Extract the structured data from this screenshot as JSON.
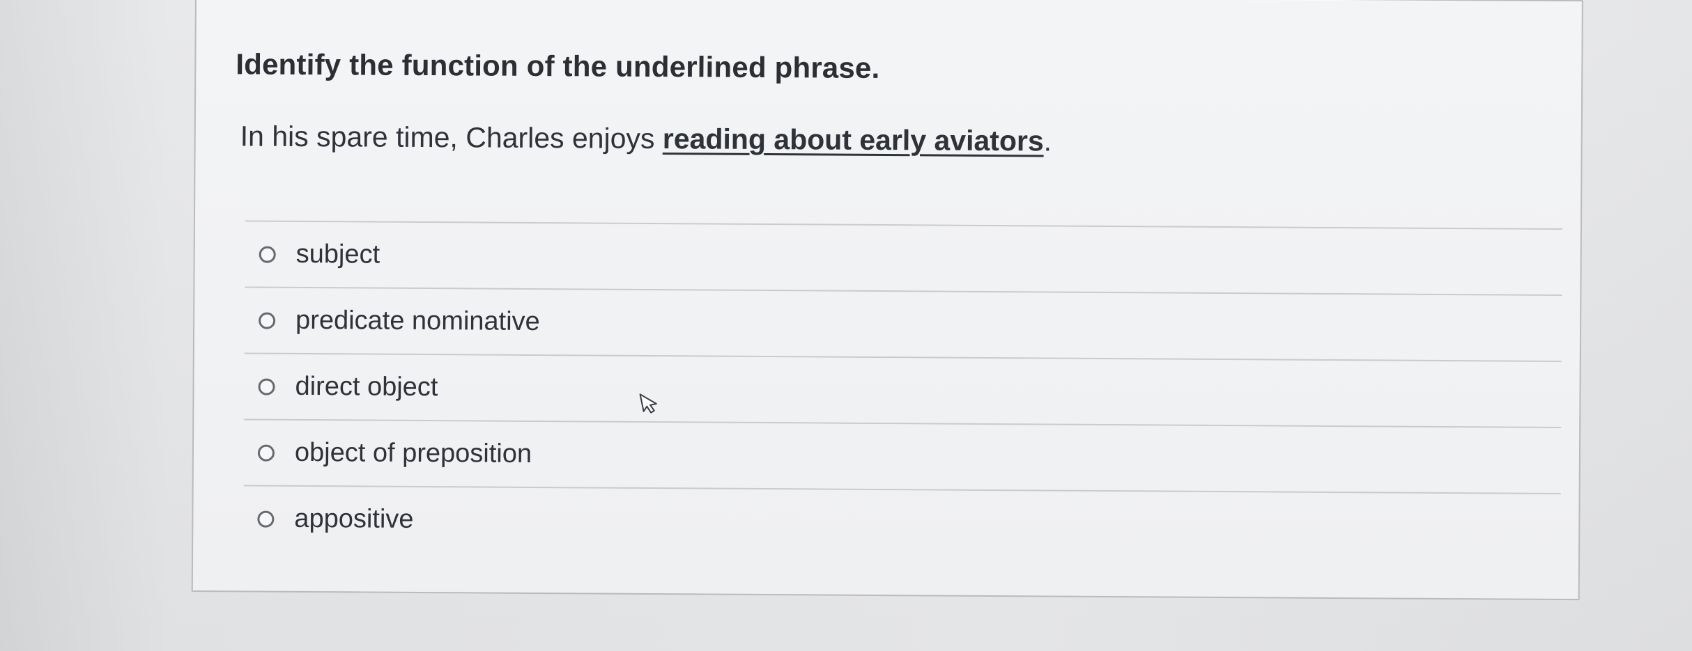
{
  "question": {
    "prompt": "Identify the function of the underlined phrase.",
    "sentence_start": "In his spare time, Charles enjoys ",
    "underlined_phrase": "reading about early aviators",
    "sentence_end": "."
  },
  "answers": [
    {
      "label": "subject",
      "selected": false
    },
    {
      "label": "predicate nominative",
      "selected": false
    },
    {
      "label": "direct object",
      "selected": false
    },
    {
      "label": "object of preposition",
      "selected": false
    },
    {
      "label": "appositive",
      "selected": false
    }
  ],
  "cursor": {
    "icon": "mouse-pointer-icon"
  }
}
